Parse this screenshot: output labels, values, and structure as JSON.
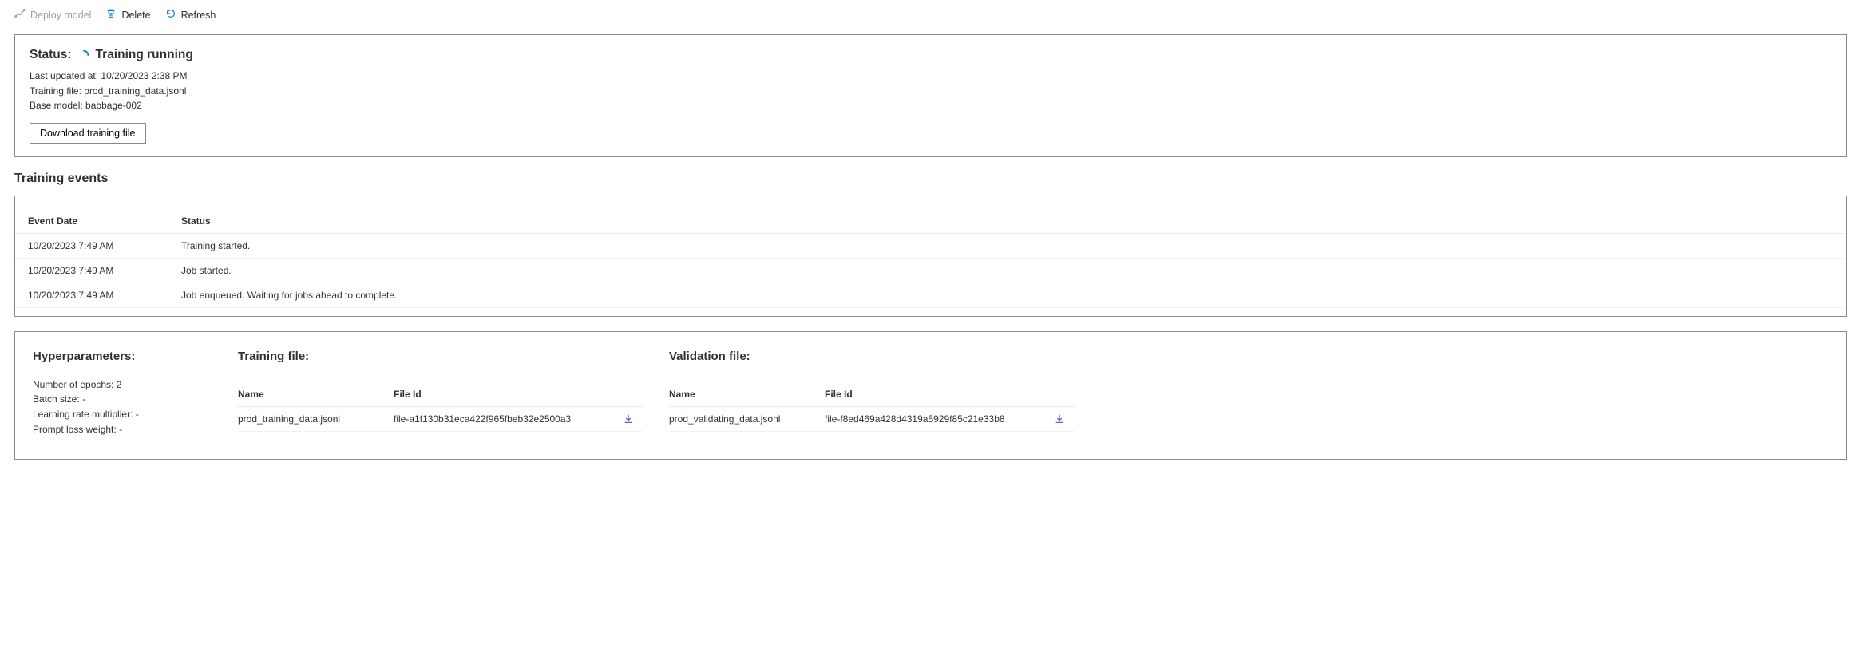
{
  "toolbar": {
    "deploy_label": "Deploy model",
    "delete_label": "Delete",
    "refresh_label": "Refresh"
  },
  "status": {
    "label": "Status:",
    "value": "Training running",
    "last_updated_label": "Last updated at:",
    "last_updated_value": "10/20/2023 2:38 PM",
    "training_file_label": "Training file:",
    "training_file_value": "prod_training_data.jsonl",
    "base_model_label": "Base model:",
    "base_model_value": "babbage-002",
    "download_btn": "Download training file"
  },
  "events": {
    "title": "Training events",
    "headers": {
      "date": "Event Date",
      "status": "Status"
    },
    "rows": [
      {
        "date": "10/20/2023 7:49 AM",
        "status": "Training started."
      },
      {
        "date": "10/20/2023 7:49 AM",
        "status": "Job started."
      },
      {
        "date": "10/20/2023 7:49 AM",
        "status": "Job enqueued. Waiting for jobs ahead to complete."
      }
    ]
  },
  "hyperparams": {
    "title": "Hyperparameters:",
    "epochs_label": "Number of epochs:",
    "epochs_value": "2",
    "batch_label": "Batch size:",
    "batch_value": "-",
    "lr_label": "Learning rate multiplier:",
    "lr_value": "-",
    "loss_label": "Prompt loss weight:",
    "loss_value": "-"
  },
  "files": {
    "headers": {
      "name": "Name",
      "file_id": "File Id"
    },
    "training": {
      "title": "Training file:",
      "name": "prod_training_data.jsonl",
      "file_id": "file-a1f130b31eca422f965fbeb32e2500a3"
    },
    "validation": {
      "title": "Validation file:",
      "name": "prod_validating_data.jsonl",
      "file_id": "file-f8ed469a428d4319a5929f85c21e33b8"
    }
  }
}
